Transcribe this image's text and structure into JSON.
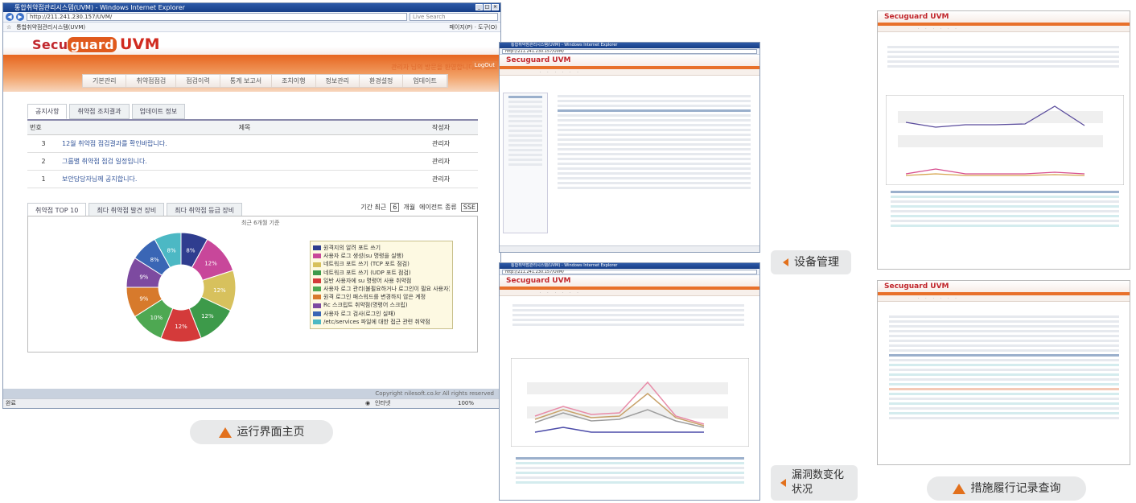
{
  "main_window": {
    "title": "통합취약점관리시스템(UVM) - Windows Internet Explorer",
    "url": "http://211.241.230.157/UVM/",
    "search_placeholder": "Live Search",
    "fav_tab": "통합취약점관리시스템(UVM)",
    "toolbar_right": "페이지(P) · 도구(O)",
    "logo_prefix": "Secu",
    "logo_badge": "guard",
    "logo_product": "UVM",
    "welcome": "관리자 님의 방문을 환영합니다.",
    "logout": "LogOut",
    "nav": [
      "기본관리",
      "취약점점검",
      "점검이력",
      "통계 보고서",
      "조치이행",
      "정보관리",
      "환경설정",
      "업데이트"
    ],
    "tabs": [
      "공지사항",
      "취약점 조치결과",
      "업데이트 정보"
    ],
    "notice_headers": [
      "번호",
      "제목",
      "작성자"
    ],
    "notices": [
      {
        "no": "3",
        "title": "12월 취약점 점검결과를 확인바랍니다.",
        "author": "관리자"
      },
      {
        "no": "2",
        "title": "그룹별 취약점 점검 일정입니다.",
        "author": "관리자"
      },
      {
        "no": "1",
        "title": "보안담당자님께 공지합니다.",
        "author": "관리자"
      }
    ],
    "tabs2": [
      "취약점 TOP 10",
      "최다 취약점 발견 장비",
      "최다 취약점 등급 장비"
    ],
    "period_label": "기간 최근",
    "period_value": "6",
    "period_unit": "개월",
    "agent_label": "에이전트 종류",
    "agent_value": "SSE",
    "chart_note": "최근 6개월 기준",
    "status_left": "완료",
    "status_zone": "인터넷",
    "zoom": "100%",
    "copyright": "Copyright nilesoft.co.kr All rights reserved"
  },
  "chart_data": {
    "type": "pie",
    "labels": [
      "8%",
      "12%",
      "12%",
      "12%",
      "12%",
      "10%",
      "9%",
      "9%",
      "8%",
      "8%"
    ],
    "values": [
      8,
      12,
      12,
      12,
      12,
      10,
      9,
      9,
      8,
      8
    ],
    "colors": [
      "#2f3d8f",
      "#c8479a",
      "#d7c15d",
      "#3d9a4a",
      "#d43a3a",
      "#4ea852",
      "#d77a2c",
      "#7d4aa0",
      "#3a66b5",
      "#4cb8c4"
    ],
    "series_labels": [
      "원격지의 알려 포트 쓰기",
      "사용자 로그 생성(su 명령을 실행)",
      "네트워크 포트 쓰기 (TCP 포트 점검)",
      "네트워크 포트 쓰기 (UDP 포트 점검)",
      "일반 사용자에 su 명령어 사용 취약점",
      "사용자 로그 관리(불필요하거나 로그인이 필요 사용자)",
      "원격 로그인 패스워드를 변경하지 않은 계정",
      "Rc 스크립트 취약점(명령어 스크립)",
      "사용자 로그 검사(로그인 실패)",
      "/etc/services 파일에 대한 접근 관련 취약점"
    ]
  },
  "captions": {
    "main": "运行界面主页",
    "device": "设备管理",
    "vuln_change": "漏洞数变化状况",
    "measures": "措施履行记录查询"
  },
  "mini_windows": {
    "device_title": "통합취약점관리시스템(UVM) - Windows Internet Explorer",
    "device_url": "http://211.241.230.157/UVM/",
    "vuln_title": "통합취약점관리시스템(UVM) - Windows Internet Explorer",
    "vuln_url": "http://211.241.230.157/UVM/",
    "logo": "Secuguard UVM"
  }
}
